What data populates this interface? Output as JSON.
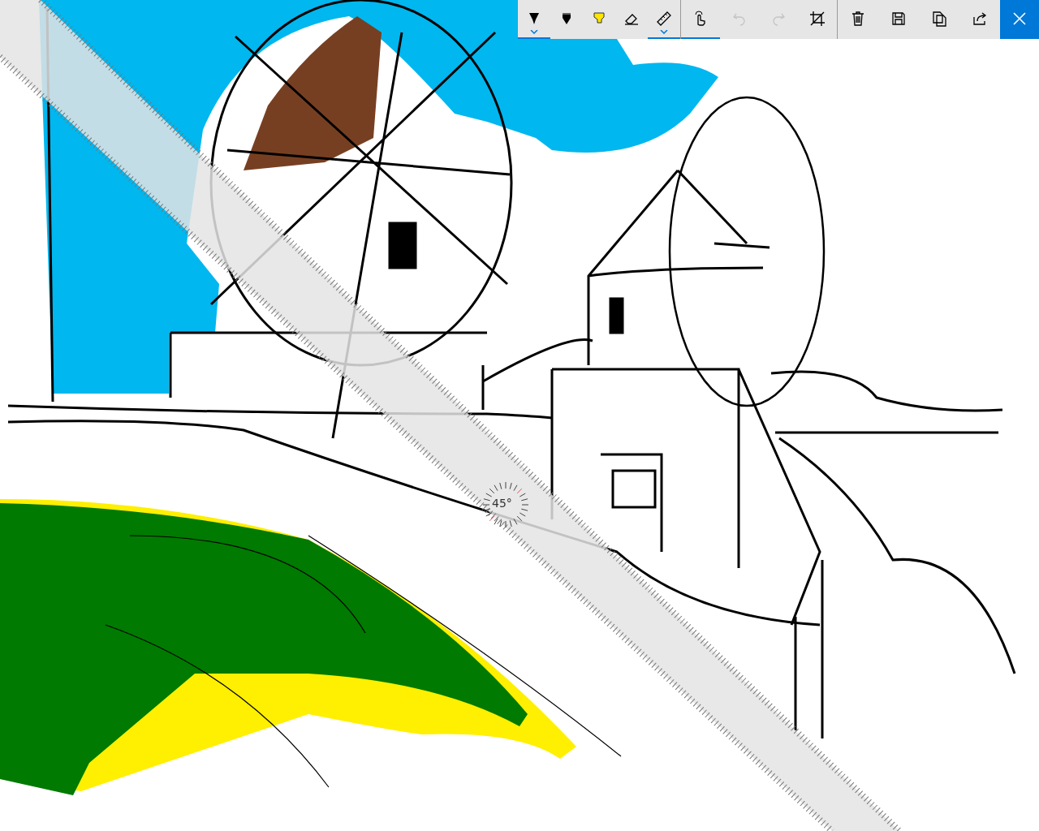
{
  "toolbar": {
    "tools": [
      {
        "kind": "ballpoint",
        "selected": true,
        "dropdown": true,
        "disabled": false
      },
      {
        "kind": "pencil",
        "selected": false,
        "dropdown": false,
        "disabled": false
      },
      {
        "kind": "highlighter",
        "selected": false,
        "dropdown": false,
        "disabled": false
      },
      {
        "kind": "eraser",
        "selected": false,
        "dropdown": false,
        "disabled": false
      },
      {
        "kind": "ruler",
        "selected": true,
        "dropdown": true,
        "disabled": false
      },
      {
        "kind": "touch",
        "selected": true,
        "dropdown": false,
        "disabled": false
      },
      {
        "kind": "undo",
        "selected": false,
        "dropdown": false,
        "disabled": true
      },
      {
        "kind": "redo",
        "selected": false,
        "dropdown": false,
        "disabled": true
      },
      {
        "kind": "crop",
        "selected": false,
        "dropdown": false,
        "disabled": false
      },
      {
        "kind": "delete",
        "selected": false,
        "dropdown": false,
        "disabled": false
      },
      {
        "kind": "save",
        "selected": false,
        "dropdown": false,
        "disabled": false
      },
      {
        "kind": "copy",
        "selected": false,
        "dropdown": false,
        "disabled": false
      },
      {
        "kind": "share",
        "selected": false,
        "dropdown": false,
        "disabled": false
      },
      {
        "kind": "close",
        "selected": false,
        "dropdown": false,
        "disabled": false
      }
    ]
  },
  "ruler": {
    "angle": "45°"
  }
}
